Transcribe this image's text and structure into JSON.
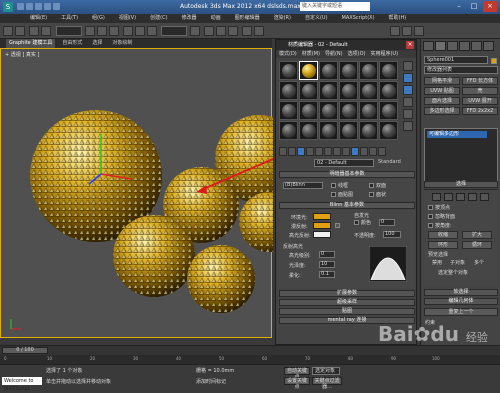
{
  "app": {
    "title": "Autodesk 3ds Max  2012 x64    dslsds.max",
    "search_placeholder": "键入关键字或短语",
    "logo_letter": "S"
  },
  "menu": [
    "编辑(E)",
    "工具(T)",
    "组(G)",
    "视图(V)",
    "创建(C)",
    "修改器",
    "动画",
    "图形编辑器",
    "渲染(R)",
    "自定义(U)",
    "MAXScript(X)",
    "帮助(H)"
  ],
  "graphite_tabs": [
    {
      "label": "Graphite 建模工具",
      "active": true
    },
    {
      "label": "自由形式",
      "active": false
    },
    {
      "label": "选择",
      "active": false
    },
    {
      "label": "对象绘制",
      "active": false
    }
  ],
  "viewport": {
    "label": "+ 透视 ] 真实 ]"
  },
  "material_editor": {
    "title": "材质编辑器 - 02 - Default",
    "menu": [
      "模式(D)",
      "材质(M)",
      "导航(N)",
      "选项(O)",
      "实用程序(U)"
    ],
    "material_name": "02 - Default",
    "material_type": "Standard",
    "shader_rollout": "明暗器基本参数",
    "shader_type": "(B)Blinn",
    "wire_label": "线框",
    "two_sided_label": "双面",
    "face_map_label": "面贴图",
    "faceted_label": "面状",
    "blinn_rollout": "Blinn 基本参数",
    "ambient_label": "环境光:",
    "diffuse_label": "漫反射:",
    "specular_label": "高光反射:",
    "self_illum_label": "自发光",
    "color_label": "颜色",
    "self_illum_value": "0",
    "opacity_label": "不透明度:",
    "opacity_value": "100",
    "highlights_label": "反射高光",
    "spec_level_label": "高光级别:",
    "spec_level_value": "0",
    "glossiness_label": "光泽度:",
    "glossiness_value": "10",
    "soften_label": "柔化:",
    "soften_value": "0.1",
    "rollouts": [
      "扩展参数",
      "超级采样",
      "贴图",
      "mental ray 连接"
    ]
  },
  "command_panel": {
    "object_name": "Sphere001",
    "modifier_list": "修改器列表",
    "buttons": [
      "网格平滑",
      "FFD 长方体",
      "UVW 贴图",
      "壳",
      "面片选择",
      "UVW 展开",
      "多边形选择",
      "FFD 2x2x2"
    ],
    "stack_item": "可编辑多边形",
    "selection_rollout": "选择",
    "by_vertex_label": "按顶点",
    "ignore_backfacing_label": "忽略背面",
    "by_angle_label": "按角度:",
    "shrink_label": "收缩",
    "grow_label": "扩大",
    "ring_label": "环形",
    "loop_label": "循环",
    "preview_label": "预览选择",
    "disabled_label": "禁用",
    "subobject_label": "子对象",
    "multi_label": "多个",
    "whole_selected": "选定整个对象",
    "soft_selection_rollout": "软选择",
    "edit_geometry_rollout": "编辑几何体",
    "repeat_last": "重复上一个",
    "constraints_label": "约束"
  },
  "timeline": {
    "frame_display": "0 / 100",
    "ticks": [
      "0",
      "10",
      "20",
      "30",
      "40",
      "50",
      "60",
      "70",
      "80",
      "90",
      "100"
    ]
  },
  "status": {
    "selected": "选择了 1 个对象",
    "hint": "单击并拖动以选择并移动对象",
    "welcome": "Welcome to MAXScript.",
    "auto_key": "自动关键点",
    "selected_obj": "选定对象",
    "set_key": "设置关键点",
    "key_filter": "关键点过滤器...",
    "add_time_tag": "添加时间标记",
    "grid": "栅格 = 10.0mm"
  },
  "watermark": {
    "text": "Bai",
    "paw": "du",
    "tail": "经验"
  },
  "colors": {
    "diffuse": "#e0a010",
    "selection_blue": "#2f66b0",
    "annotation_red": "#e01818"
  }
}
